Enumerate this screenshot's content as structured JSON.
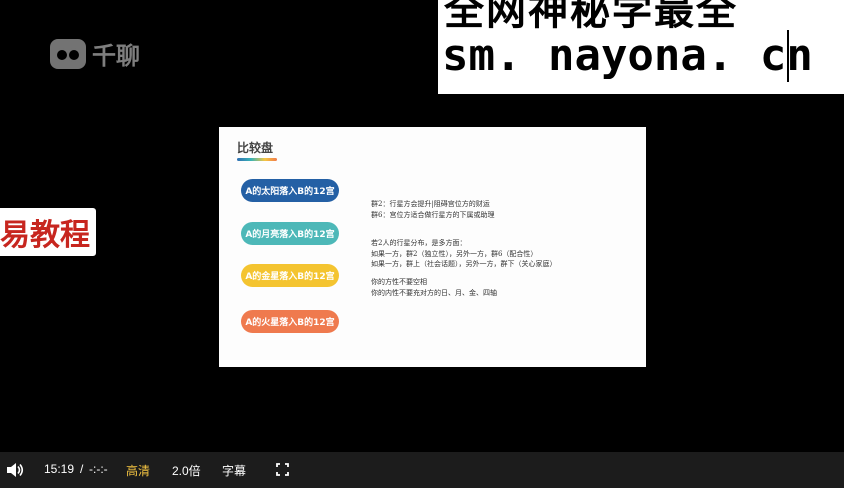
{
  "logo": {
    "text": "千聊"
  },
  "banner": {
    "top_text": "全网神秘学最全",
    "url_text": "sm. nayona. cn"
  },
  "side_tag": {
    "text": "易教程"
  },
  "slide": {
    "title": "比较盘",
    "pills": [
      {
        "label": "A的太阳落入B的12宫",
        "color": "#2460a5"
      },
      {
        "label": "A的月亮落入B的12宫",
        "color": "#4db8b8"
      },
      {
        "label": "A的金星落入B的12宫",
        "color": "#f4c430"
      },
      {
        "label": "A的火星落入B的12宫",
        "color": "#ef7a4e"
      }
    ],
    "notes_block1": [
      "群2：行星方会提升|阻碍宫位方的财运",
      "群6：宫位方适合做行星方的下属或助理"
    ],
    "notes_block2": [
      "若2人的行星分布，是多方面：",
      "如果一方，群2（独立性），另外一方，群6（配合性）",
      "如果一方，群上（社会话题），另外一方，群下（关心家庭）"
    ],
    "notes_block3": [
      "你的方性不要空相",
      "你的内性不要充对方的日、月、金、四轴"
    ]
  },
  "controls": {
    "time": "15:19",
    "separator": "/",
    "duration": "-:-:-",
    "quality": "高清",
    "speed": "2.0倍",
    "subtitle": "字幕",
    "accent_color": "#f5c542"
  }
}
